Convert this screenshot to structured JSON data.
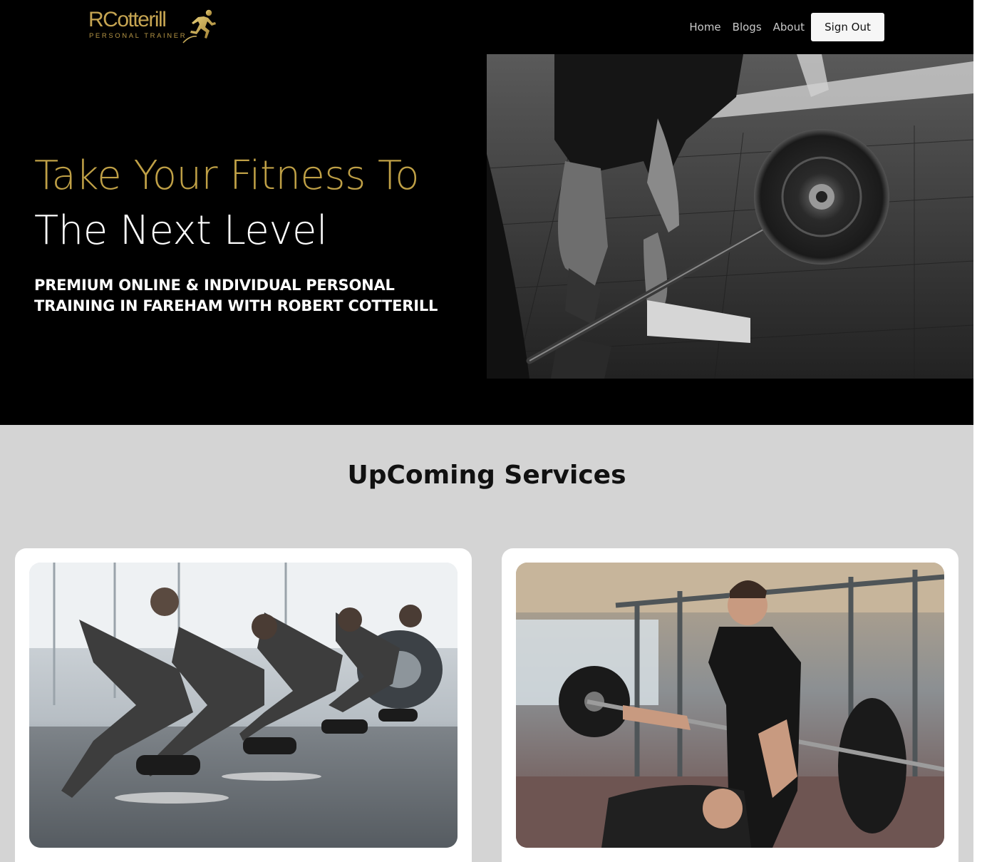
{
  "header": {
    "logo": {
      "name": "RCotterill",
      "tagline": "PERSONAL TRAINER"
    },
    "nav": {
      "home": "Home",
      "blogs": "Blogs",
      "about": "About",
      "sign_out": "Sign Out"
    }
  },
  "hero": {
    "title_line_1": "Take Your Fitness To",
    "title_line_2": "The Next Level",
    "subtitle": "PREMIUM ONLINE & INDIVIDUAL PERSONAL TRAINING IN FAREHAM WITH ROBERT COTTERILL",
    "image": "deadlift-barbell-photo"
  },
  "services": {
    "title": "UpComing Services",
    "cards": [
      {
        "image": "group-dumbbell-plank-row-photo"
      },
      {
        "image": "trainer-spotting-bench-press-photo"
      }
    ]
  },
  "colors": {
    "gold": "#bfa046",
    "header_bg": "#000000",
    "services_bg": "#d4d4d4"
  }
}
